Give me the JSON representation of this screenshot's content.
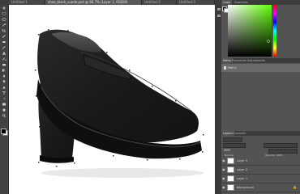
{
  "tabs": [
    {
      "label": "Untitled-1"
    },
    {
      "label": "shoe_black_suede.psd @ 66.7% (Layer 1, RGB/8)"
    },
    {
      "label": "Untitled-2"
    },
    {
      "label": "Untitled-3"
    }
  ],
  "tab_close": "×",
  "workspace_label": "Essentials",
  "color_panel": {
    "tab_color": "Color",
    "tab_swatches": "Swatches"
  },
  "mid_panel": {
    "tab_paths": "Paths",
    "tab_properties": "Properties",
    "tab_adjustments": "Adjustments",
    "path_item": "Path 1"
  },
  "layers_panel": {
    "tab_layers": "Layers",
    "tab_channels": "Channels",
    "kind_label": "Kind",
    "blend_mode": "Normal",
    "opacity_label": "Opacity: 100%",
    "lock_label": "Lock:",
    "fill_label": "Fill: 100%",
    "layers": [
      {
        "name": "Layer 3",
        "locked": false
      },
      {
        "name": "Layer 2",
        "locked": false
      },
      {
        "name": "Layer 1",
        "locked": false
      },
      {
        "name": "Background",
        "locked": true
      }
    ],
    "eye_glyph": "◉",
    "lock_glyph": "🔒"
  },
  "colors": {
    "foreground": "#000000",
    "background": "#ffffff",
    "panel_bg": "#535353",
    "selected_color": "#7cff3a"
  },
  "tool_icons": [
    "move-icon",
    "marquee-icon",
    "lasso-icon",
    "quick-select-icon",
    "crop-icon",
    "eyedropper-icon",
    "healing-icon",
    "brush-icon",
    "stamp-icon",
    "history-brush-icon",
    "eraser-icon",
    "gradient-icon",
    "blur-icon",
    "dodge-icon",
    "pen-icon",
    "type-icon",
    "path-select-icon",
    "shape-icon",
    "hand-icon",
    "zoom-icon"
  ]
}
